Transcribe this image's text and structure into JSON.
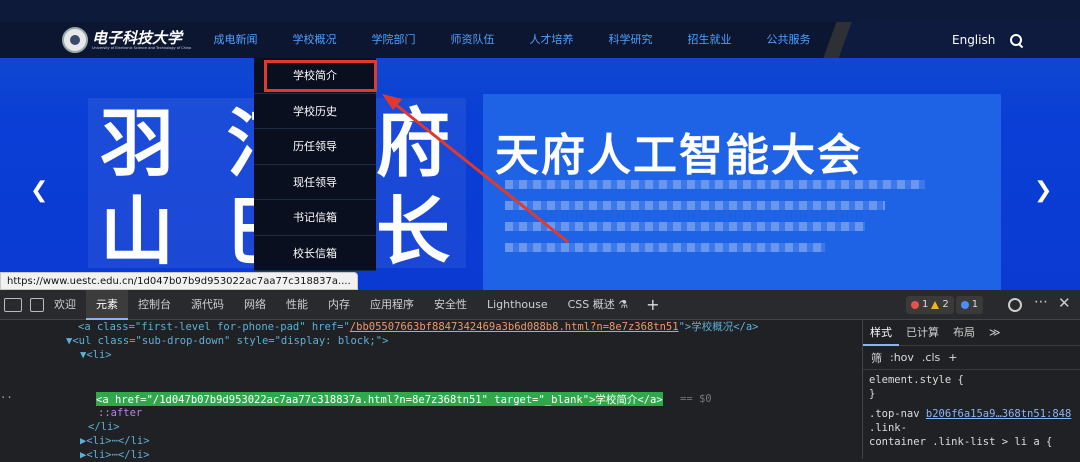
{
  "header": {
    "logo_text": "电子科技大学",
    "logo_sub": "University of Electronic Science and Technology of China",
    "nav": [
      "成电新闻",
      "学校概况",
      "学院部门",
      "师资队伍",
      "人才培养",
      "科学研究",
      "招生就业",
      "公共服务"
    ],
    "lang": "English"
  },
  "dropdown": {
    "items": [
      "学校简介",
      "学校历史",
      "历任领导",
      "现任领导",
      "书记信箱",
      "校长信箱"
    ]
  },
  "banner": {
    "left_text_1": "羽 汀",
    "left_text_2": "山 巴",
    "left_text_r1": "府",
    "left_text_r2": "长",
    "right_title": "天府人工智能大会"
  },
  "status_url": "https://www.uestc.edu.cn/1d047b07b9d953022ac7aa77c318837a....",
  "devtools": {
    "tabs": [
      "欢迎",
      "元素",
      "控制台",
      "源代码",
      "网络",
      "性能",
      "内存",
      "应用程序",
      "安全性",
      "Lighthouse",
      "CSS 概述 ⚗"
    ],
    "active_tab": "元素",
    "badges": {
      "errors": "1",
      "warnings": "2",
      "info": "1"
    },
    "lines": {
      "l1_a": "<a class=\"first-level for-phone-pad\" href=\"",
      "l1_href": "/bb05507663bf8847342469a3b6d088b8.html?n=8e7z368tn51",
      "l1_tail": "\">学校概况</a>",
      "l2": "▼<ul class=\"sub-drop-down\" style=\"display: block;\">",
      "l3": "▼<li>",
      "l4": "<a href=\"/1d047b07b9d953022ac7aa77c318837a.html?n=8e7z368tn51\" target=\"_blank\">学校简介</a>",
      "l4_suffix": "== $0",
      "l5": "::after",
      "l6": "</li>",
      "l7": "▶<li>⋯</li>",
      "l8": "▶<li>⋯</li>",
      "l9": "▶<li>⋯</li>",
      "l10": "▶<li>⋯</li>",
      "gutter": "··"
    },
    "styles": {
      "tabs": [
        "样式",
        "已计算",
        "布局",
        "≫"
      ],
      "active_tab": "样式",
      "filter": "筛",
      "toolbar": [
        ":hov",
        ".cls",
        "+"
      ],
      "element_style": "element.style {",
      "close_brace": "}",
      "rule_selector_1": ".top-nav",
      "rule_link": "b206f6a15a9…368tn51:848",
      "rule_selector_2": ".link-",
      "rule_selector_3": "container .link-list > li a {"
    }
  },
  "colors": {
    "nav_link": "#4fa0ff",
    "highlight_red": "#e03a2e",
    "selected_green": "#2ea84a"
  }
}
